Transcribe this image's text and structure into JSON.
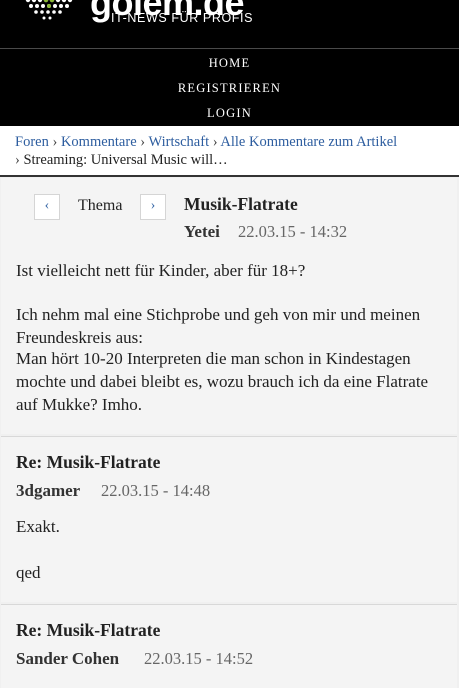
{
  "header": {
    "logo_text": "golem.de",
    "tagline": "IT-NEWS FÜR PROFIS"
  },
  "menu": {
    "items": [
      "HOME",
      "REGISTRIEREN",
      "LOGIN"
    ]
  },
  "breadcrumb": {
    "links": [
      "Foren",
      "Kommentare",
      "Wirtschaft",
      "Alle Kommentare zum Artikel"
    ],
    "separator": "›",
    "current": "Streaming: Universal Music will…"
  },
  "thread": {
    "prev_label": "‹",
    "topic_label": "Thema",
    "next_label": "›"
  },
  "posts": [
    {
      "title": "Musik-Flatrate",
      "author": "Yetei",
      "date": "22.03.15 - 14:32",
      "paragraphs": [
        "Ist vielleicht nett für Kinder, aber für 18+?",
        "Ich nehm mal eine Stichprobe und geh von mir und meinen Freundeskreis aus:",
        "Man hört 10-20 Interpreten die man schon in Kindestagen mochte und dabei bleibt es, wozu brauch ich da eine Flatrate auf Mukke? Imho."
      ]
    },
    {
      "title": "Re: Musik-Flatrate",
      "author": "3dgamer",
      "date": "22.03.15 - 14:48",
      "paragraphs": [
        "Exakt.",
        "qed"
      ]
    },
    {
      "title": "Re: Musik-Flatrate",
      "author": "Sander Cohen",
      "date": "22.03.15 - 14:52",
      "paragraphs": []
    }
  ]
}
